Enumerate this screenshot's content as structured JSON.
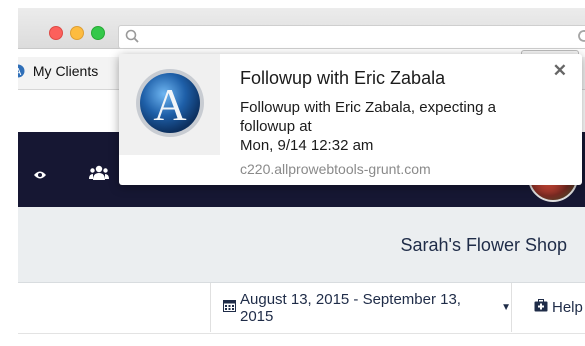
{
  "browser": {
    "url": "",
    "bookmark_label": "My Clients"
  },
  "notification": {
    "title": "Followup with Eric Zabala",
    "body_line1": "Followup with Eric Zabala, expecting a followup at",
    "body_line2": "Mon, 9/14 12:32 am",
    "source": "c220.allprowebtools-grunt.com",
    "close_glyph": "✕",
    "logo_letter": "A"
  },
  "page": {
    "shop_name": "Sarah's Flower Shop",
    "date_range": "August 13, 2015 - September 13, 2015",
    "help_label": "Help"
  },
  "colors": {
    "navbar": "#161733",
    "text_dark": "#1f2c48"
  },
  "icons": {
    "nav": [
      "eye-icon",
      "users-icon"
    ],
    "toolbar": [
      "calendar-icon",
      "chevron-down-icon",
      "medkit-icon"
    ],
    "browser": [
      "search-icon",
      "reload-icon"
    ]
  }
}
